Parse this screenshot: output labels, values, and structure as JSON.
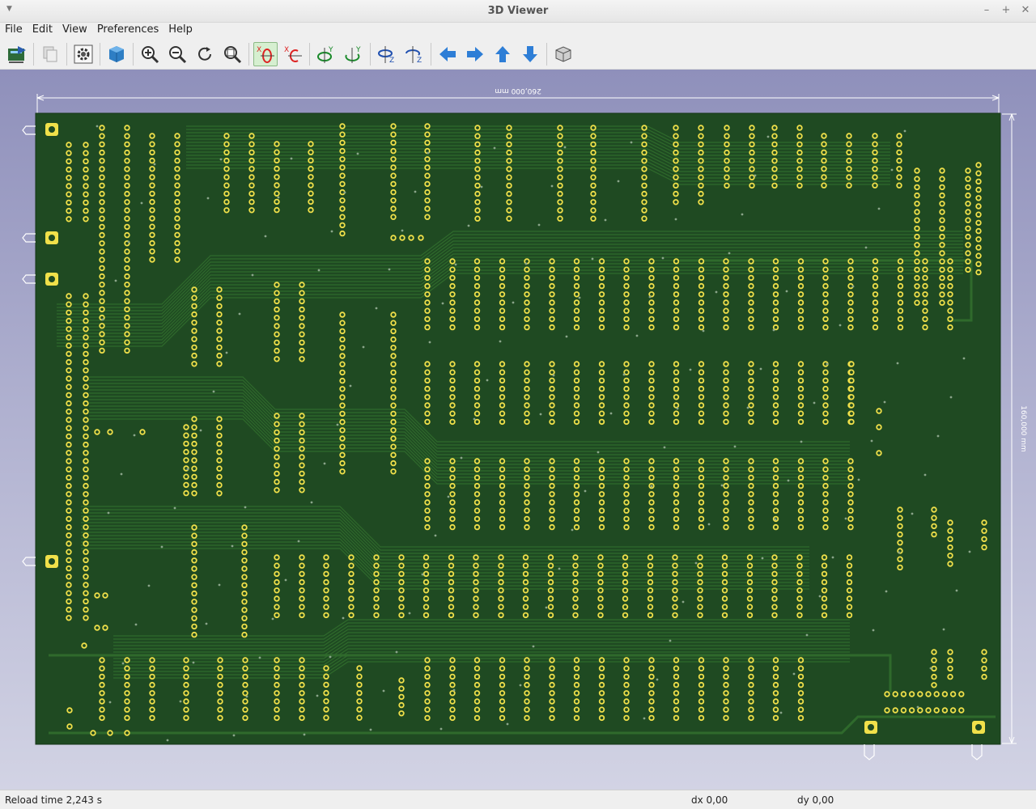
{
  "window": {
    "title": "3D Viewer"
  },
  "menubar": {
    "items": [
      "File",
      "Edit",
      "View",
      "Preferences",
      "Help"
    ]
  },
  "toolbar": {
    "buttons": [
      {
        "name": "reload-board-button",
        "icon": "reload-board-icon"
      },
      {
        "name": "copy-image-button",
        "icon": "copy-icon"
      },
      {
        "name": "settings-button",
        "icon": "gear-icon"
      },
      {
        "name": "raytracing-button",
        "icon": "cube-render-icon"
      },
      {
        "name": "zoom-in-button",
        "icon": "zoom-in-icon"
      },
      {
        "name": "zoom-out-button",
        "icon": "zoom-out-icon"
      },
      {
        "name": "redraw-button",
        "icon": "redraw-icon"
      },
      {
        "name": "zoom-fit-button",
        "icon": "zoom-fit-icon"
      },
      {
        "name": "rotate-x-cw-button",
        "icon": "rotate-x-cw-icon"
      },
      {
        "name": "rotate-x-ccw-button",
        "icon": "rotate-x-ccw-icon"
      },
      {
        "name": "rotate-y-cw-button",
        "icon": "rotate-y-cw-icon"
      },
      {
        "name": "rotate-y-ccw-button",
        "icon": "rotate-y-ccw-icon"
      },
      {
        "name": "rotate-z-cw-button",
        "icon": "rotate-z-cw-icon"
      },
      {
        "name": "rotate-z-ccw-button",
        "icon": "rotate-z-ccw-icon"
      },
      {
        "name": "move-left-button",
        "icon": "arrow-left-icon"
      },
      {
        "name": "move-right-button",
        "icon": "arrow-right-icon"
      },
      {
        "name": "move-up-button",
        "icon": "arrow-up-icon"
      },
      {
        "name": "move-down-button",
        "icon": "arrow-down-icon"
      },
      {
        "name": "orthographic-toggle-button",
        "icon": "cube-wireframe-icon"
      }
    ],
    "active_button": "rotate-x-cw-button"
  },
  "viewport": {
    "width_dimension": "260,000 mm",
    "height_dimension": "160,000 mm",
    "colors": {
      "board": "#1f4a22",
      "trace": "#2f6a2c",
      "pad": "#f0e04a",
      "background_top": "#8f90bb",
      "background_bottom": "#d2d3e4"
    }
  },
  "statusbar": {
    "reload": "Reload time 2,243 s",
    "dx": "dx 0,00",
    "dy": "dy 0,00"
  }
}
